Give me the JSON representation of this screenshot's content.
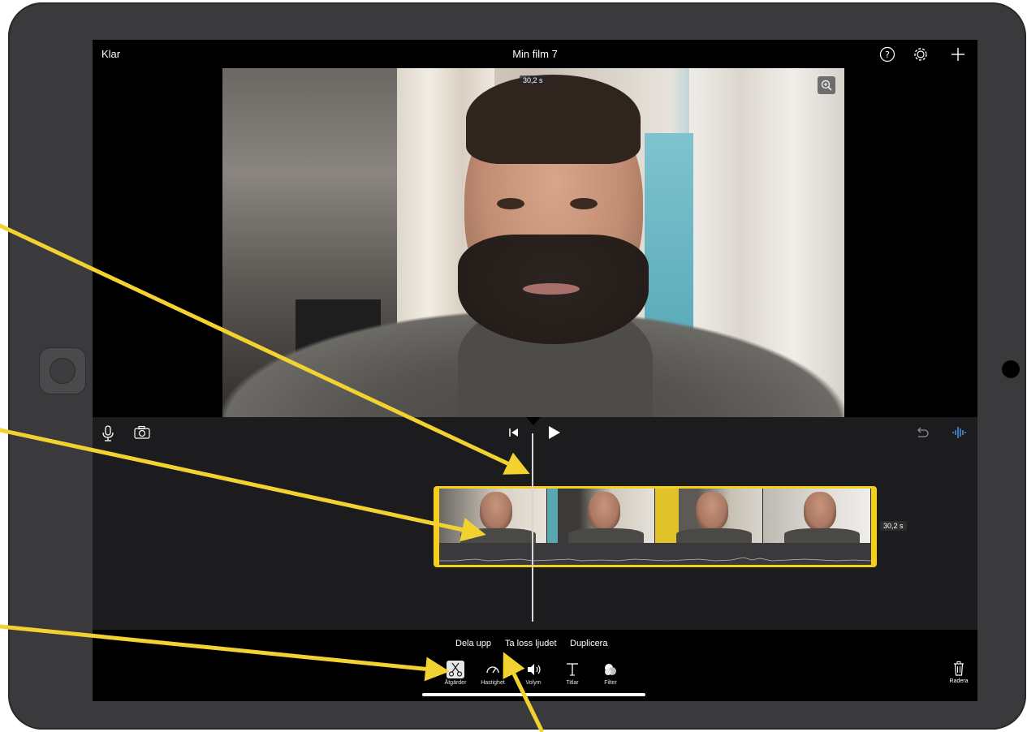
{
  "topbar": {
    "done_label": "Klar",
    "project_title": "Min film 7"
  },
  "viewer": {
    "duration_badge": "30,2 s"
  },
  "timeline": {
    "clip_duration": "30,2 s"
  },
  "actions": {
    "split": "Dela upp",
    "detach_audio": "Ta loss ljudet",
    "duplicate": "Duplicera"
  },
  "toolbar": {
    "tools": [
      {
        "label": "Åtgärder",
        "icon": "scissors-icon",
        "active": true
      },
      {
        "label": "Hastighet",
        "icon": "speed-icon",
        "active": false
      },
      {
        "label": "Volym",
        "icon": "volume-icon",
        "active": false
      },
      {
        "label": "Titlar",
        "icon": "titles-icon",
        "active": false
      },
      {
        "label": "Filter",
        "icon": "filter-icon",
        "active": false
      }
    ],
    "delete_label": "Radera"
  },
  "colors": {
    "clip_border": "#f5cf1a",
    "annotation_arrow": "#f2d230",
    "waveform_toggle": "#4aa8ff"
  }
}
